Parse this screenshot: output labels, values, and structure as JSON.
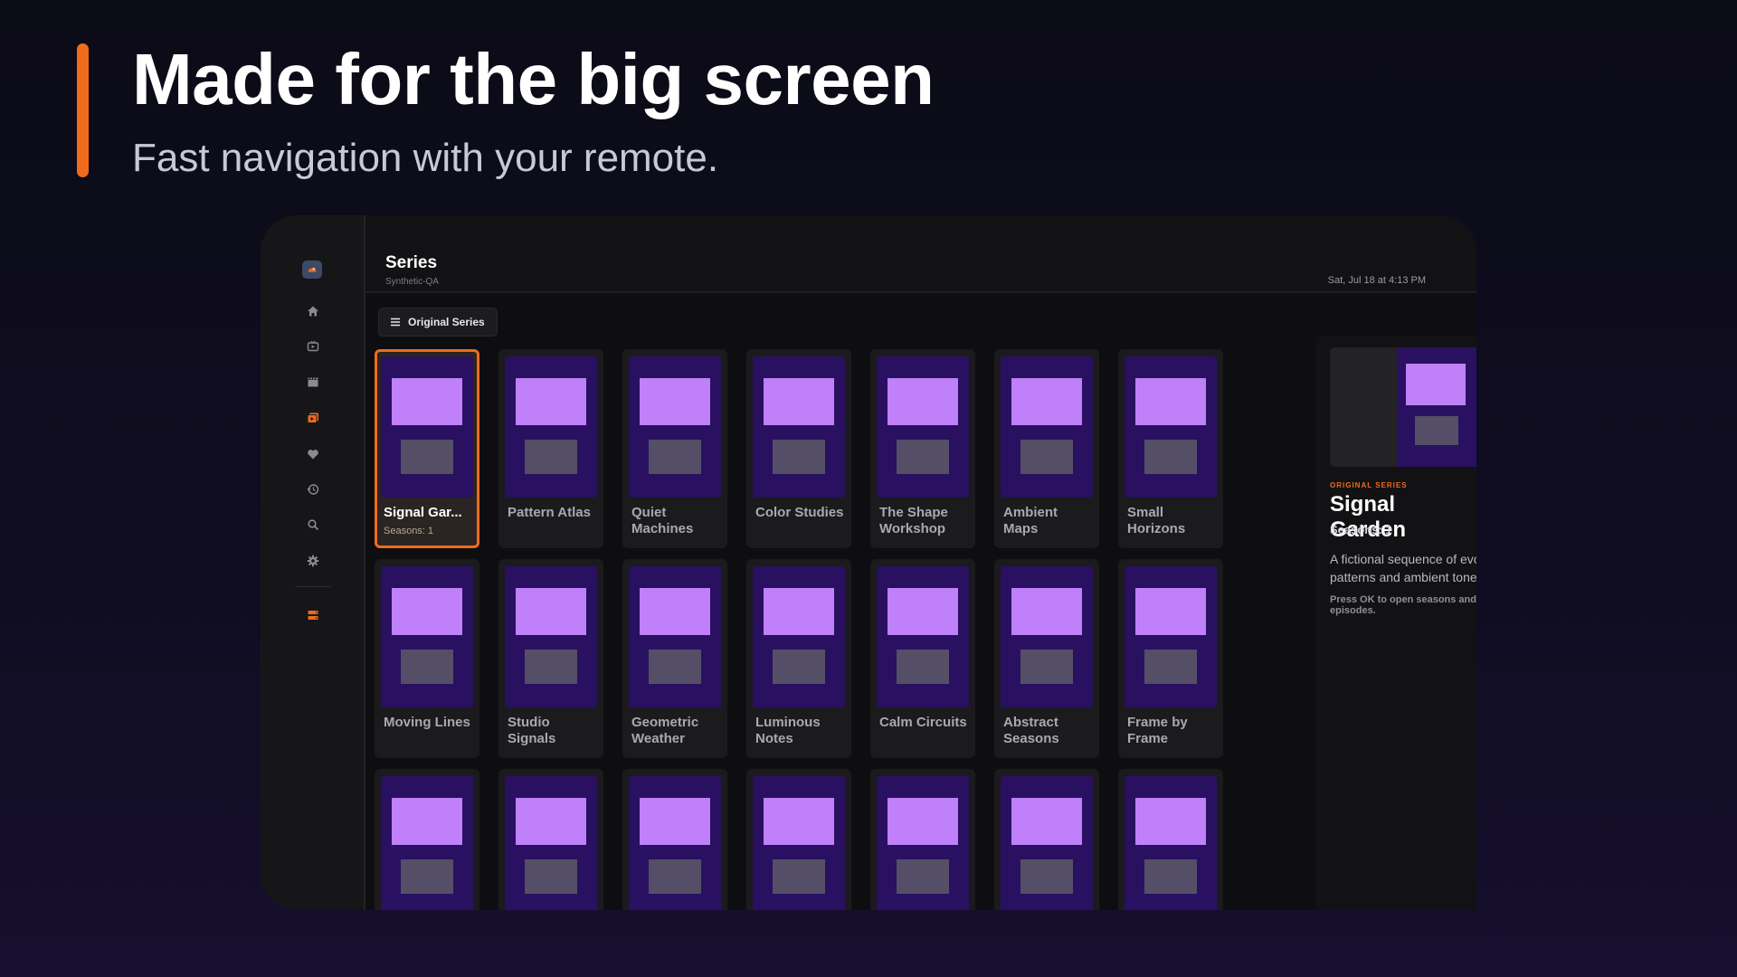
{
  "hero": {
    "title": "Made for the big screen",
    "subtitle": "Fast navigation with your remote."
  },
  "colors": {
    "accent": "#f06b1b",
    "poster_bg": "#2a1060",
    "poster_top": "#bf80fa",
    "poster_bottom": "#544f66"
  },
  "sidebar": {
    "items": [
      {
        "icon": "app-logo-icon"
      },
      {
        "icon": "home-icon"
      },
      {
        "icon": "live-tv-icon"
      },
      {
        "icon": "movies-clapper-icon"
      },
      {
        "icon": "series-icon",
        "active": true
      },
      {
        "icon": "favorites-heart-icon"
      },
      {
        "icon": "history-icon"
      },
      {
        "icon": "search-icon"
      },
      {
        "icon": "settings-gear-icon"
      },
      {
        "icon": "server-icon"
      }
    ]
  },
  "header": {
    "title": "Series",
    "subtitle": "Synthetic-QA",
    "datetime": "Sat, Jul 18 at 4:13 PM"
  },
  "filter": {
    "label": "Original Series",
    "icon": "menu-icon"
  },
  "grid": {
    "rows": [
      [
        {
          "title": "Signal Gar...",
          "meta": "Seasons: 1",
          "focused": true
        },
        {
          "title": "Pattern Atlas"
        },
        {
          "title": "Quiet Machines"
        },
        {
          "title": "Color Studies"
        },
        {
          "title": "The Shape Workshop"
        },
        {
          "title": "Ambient Maps"
        },
        {
          "title": "Small Horizons"
        }
      ],
      [
        {
          "title": "Moving Lines"
        },
        {
          "title": "Studio Signals"
        },
        {
          "title": "Geometric Weather"
        },
        {
          "title": "Luminous Notes"
        },
        {
          "title": "Calm Circuits"
        },
        {
          "title": "Abstract Seasons"
        },
        {
          "title": "Frame by Frame"
        }
      ],
      [
        {
          "title": ""
        },
        {
          "title": ""
        },
        {
          "title": ""
        },
        {
          "title": ""
        },
        {
          "title": ""
        },
        {
          "title": ""
        },
        {
          "title": ""
        }
      ]
    ]
  },
  "detail": {
    "kicker": "ORIGINAL SERIES",
    "title": "Signal Garden",
    "seasons": "Seasons: 1",
    "description": "A fictional sequence of evolving patterns and ambient tones.",
    "hint": "Press OK to open seasons and episodes."
  }
}
